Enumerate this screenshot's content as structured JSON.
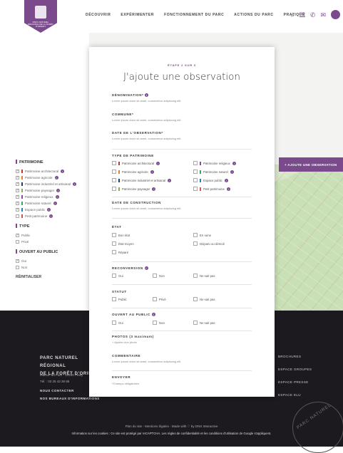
{
  "nav": {
    "logo_text": "PARC NATUREL RÉGIONAL DE LA FORÊT D'ORIENT",
    "items": [
      "DÉCOUVRIR",
      "EXPÉRIMENTER",
      "FONCTIONNEMENT DU PARC",
      "ACTIONS DU PARC",
      "PRATIQUE"
    ],
    "lang": "FR",
    "icons": [
      "search-icon",
      "phone-icon",
      "mail-icon",
      "user-icon"
    ],
    "accent": "#7a4a8c"
  },
  "sidebar": {
    "patrimoine_title": "PATRIMOINE",
    "patrimoine_items": [
      {
        "label": "Patrimoine architectural",
        "checked": true,
        "color": "#c0392b"
      },
      {
        "label": "Patrimoine agricole",
        "checked": true,
        "color": "#e67e22"
      },
      {
        "label": "Patrimoine industriel et artisanal",
        "checked": true,
        "color": "#2c3e50"
      },
      {
        "label": "Patrimoine paysager",
        "checked": true,
        "color": "#7cb342"
      },
      {
        "label": "Patrimoine religieux",
        "checked": true,
        "color": "#8e44ad"
      },
      {
        "label": "Patrimoine naturel",
        "checked": true,
        "color": "#27ae60"
      },
      {
        "label": "Espace public",
        "checked": true,
        "color": "#2980b9"
      },
      {
        "label": "Petit patrimoine",
        "checked": false,
        "color": "#e74c3c"
      }
    ],
    "type_title": "TYPE",
    "type_items": [
      {
        "label": "Public",
        "checked": true
      },
      {
        "label": "Privé",
        "checked": false
      }
    ],
    "ouvert_title": "OUVERT AU PUBLIC",
    "ouvert_items": [
      {
        "label": "Oui",
        "checked": true
      },
      {
        "label": "Non",
        "checked": false
      }
    ],
    "reset_label": "RÉINITIALISER"
  },
  "add_button": "+ AJOUTE UNE OBSERVATION",
  "modal": {
    "step": "ÉTAPE 2 SUR 3",
    "title": "J'ajoute une observation",
    "fields": {
      "denomination": {
        "label": "DÉNOMINATION*",
        "placeholder": "Lorem ipsum dolor sit amet, consectetur adipiscing elit."
      },
      "commune": {
        "label": "COMMUNE*",
        "placeholder": "Lorem ipsum dolor sit amet, consectetur adipiscing elit."
      },
      "date_observation": {
        "label": "DATE DE L'OBSERVATION*",
        "placeholder": "Lorem ipsum dolor sit amet, consectetur adipiscing elit."
      },
      "date_construction": {
        "label": "DATE DE CONSTRUCTION",
        "placeholder": "Lorem ipsum dolor sit amet, consectetur adipiscing elit."
      },
      "commentaire": {
        "label": "COMMENTAIRE",
        "placeholder": "Lorem ipsum dolor sit amet, consectetur adipiscing elit."
      }
    },
    "type_patrimoine": {
      "label": "TYPE DE PATRIMOINE",
      "options": [
        {
          "label": "Patrimoine architectural",
          "color": "#c0392b"
        },
        {
          "label": "Patrimoine religieux",
          "color": "#8e44ad"
        },
        {
          "label": "Patrimoine agricole",
          "color": "#e67e22"
        },
        {
          "label": "Patrimoine naturel",
          "color": "#27ae60"
        },
        {
          "label": "Patrimoine industriel et artisanal",
          "color": "#2c3e50"
        },
        {
          "label": "Espace public",
          "color": "#2980b9"
        },
        {
          "label": "Patrimoine paysager",
          "color": "#7cb342"
        },
        {
          "label": "Petit patrimoine",
          "color": "#e74c3c"
        }
      ]
    },
    "etat": {
      "label": "ÉTAT",
      "options": [
        "Bon état",
        "En ruine",
        "État moyen",
        "Disparu ou démoli",
        "Réparé"
      ]
    },
    "reconversion": {
      "label": "RECONVERSION",
      "options": [
        "Oui",
        "Non",
        "Ne sait pas"
      ]
    },
    "statut": {
      "label": "STATUT",
      "options": [
        "Public",
        "Privé",
        "Ne sait pas"
      ]
    },
    "ouvert": {
      "label": "OUVERT AU PUBLIC",
      "options": [
        "Oui",
        "Non",
        "Ne sait pas"
      ]
    },
    "photos": {
      "label": "PHOTOS (3 maximum)",
      "add_label": "+ Ajouter une photo"
    },
    "envoyer": {
      "label": "ENVOYER",
      "note": "*Champs obligatoires"
    }
  },
  "footer": {
    "title_line1": "PARC NATUREL RÉGIONAL",
    "title_line2": "DE LA FORÊT D'ORIENT",
    "address": "Maison du Parc - 10220 Piney",
    "phone": "Tél. : 03 25 43 38 88",
    "contact_link": "NOUS CONTACTER",
    "bureaux_link": "NOS BUREAUX D'INFORMATIONS",
    "right_links": [
      "BROCHURES",
      "ESPACE GROUPES",
      "ESPACE PRESSE",
      "ESPACE ELU"
    ],
    "legal": "Plan du site - Mentions légales - Made with ♡ by DNS Interactive",
    "cookies": "Information sur les cookies : Ce site est protégé par reCAPTCHA. Les règles de confidentialité et les conditions d'utilisation de Google s'appliquent.",
    "stamp_text": "PARC NATUREL"
  }
}
